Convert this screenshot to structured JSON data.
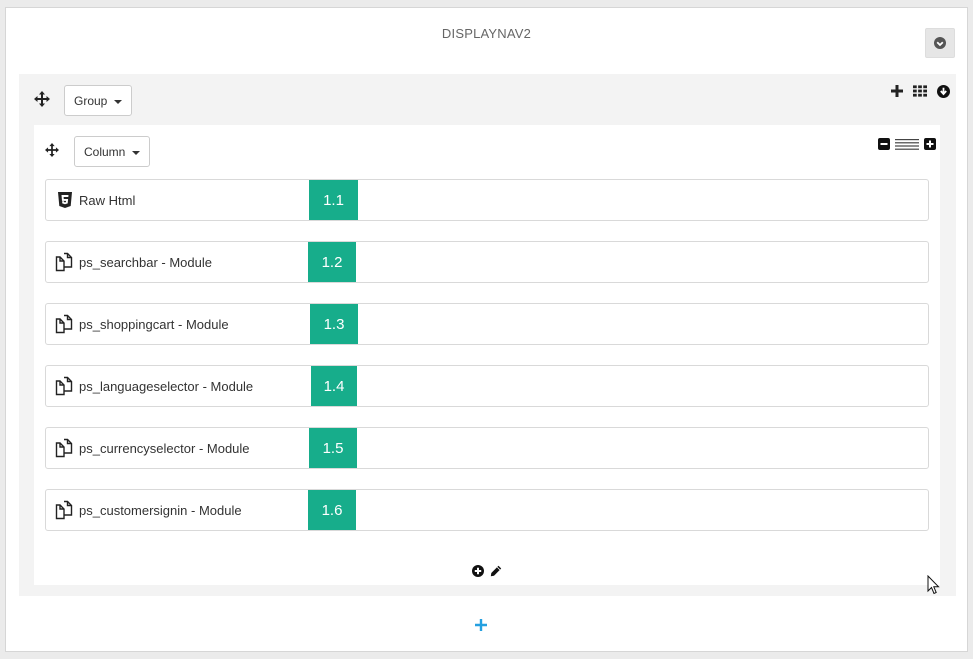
{
  "hook": {
    "title": "DISPLAYNAV2",
    "collapse_icon": "circle-arrow-down-icon"
  },
  "group": {
    "dropdown_label": "Group",
    "tools": [
      "plus-icon",
      "grid-icon",
      "circle-arrow-down-icon"
    ]
  },
  "column": {
    "dropdown_label": "Column",
    "tools": [
      "minus-square-icon",
      "lines-icon",
      "plus-square-icon"
    ],
    "footer_tools": [
      "circle-plus-icon",
      "pencil-icon"
    ]
  },
  "modules": [
    {
      "label": "Raw Html",
      "badge": "1.1",
      "icon": "html5-icon"
    },
    {
      "label": "ps_searchbar - Module",
      "badge": "1.2",
      "icon": "copy-icon"
    },
    {
      "label": "ps_shoppingcart - Module",
      "badge": "1.3",
      "icon": "copy-icon"
    },
    {
      "label": "ps_languageselector - Module",
      "badge": "1.4",
      "icon": "copy-icon"
    },
    {
      "label": "ps_currencyselector - Module",
      "badge": "1.5",
      "icon": "copy-icon"
    },
    {
      "label": "ps_customersignin - Module",
      "badge": "1.6",
      "icon": "copy-icon"
    }
  ],
  "add_group_icon": "plus-icon",
  "colors": {
    "badge": "#17ad8b",
    "add_link": "#25a0e0",
    "panel_bg": "#f3f3f3"
  }
}
